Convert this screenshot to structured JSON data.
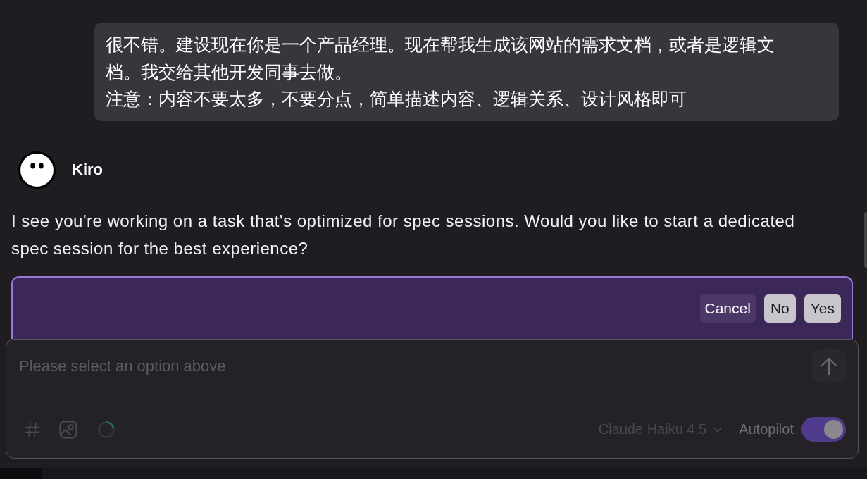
{
  "conversation": {
    "user_message": {
      "paragraphs": [
        "很不错。建设现在你是一个产品经理。现在帮我生成该网站的需求文档，或者是逻辑文档。我交给其他开发同事去做。",
        "注意：内容不要太多，不要分点，简单描述内容、逻辑关系、设计风格即可"
      ]
    },
    "assistant": {
      "name": "Kiro",
      "message": "I see you're working on a task that's optimized for spec sessions. Would you like to start a dedicated spec session for the best experience?"
    },
    "prompt": {
      "buttons": [
        {
          "label": "Cancel",
          "kind": "secondary"
        },
        {
          "label": "No",
          "kind": "primary"
        },
        {
          "label": "Yes",
          "kind": "primary"
        }
      ]
    }
  },
  "composer": {
    "placeholder": "Please select an option above",
    "send_button": {
      "disabled": true
    },
    "model": "Claude Haiku 4.5",
    "autopilot": {
      "label": "Autopilot",
      "on": true
    }
  }
}
